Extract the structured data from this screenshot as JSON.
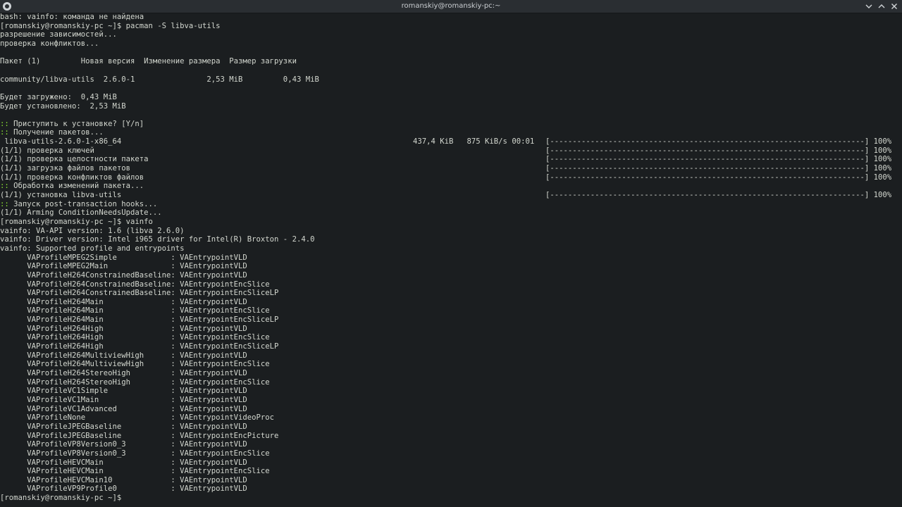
{
  "window": {
    "title": "romanskiy@romanskiy-pc:~",
    "icons": {
      "app": "terminal-app-icon",
      "minimize": "minimize-icon",
      "maximize": "maximize-icon",
      "close": "close-icon"
    }
  },
  "terminal": {
    "lines": [
      "bash: vainfo: команда не найдена",
      "[romanskiy@romanskiy-pc ~]$ pacman -S libva-utils",
      "разрешение зависимостей...",
      "проверка конфликтов...",
      "",
      "Пакет (1)         Новая версия  Изменение размера  Размер загрузки",
      "",
      "community/libva-utils  2.6.0-1                2,53 MiB         0,43 MiB",
      "",
      "Будет загружено:  0,43 MiB",
      "Будет установлено:  2,53 MiB",
      "",
      ":: Приступить к установке? [Y/n]",
      ":: Получение пакетов...",
      " libva-utils-2.6.0-1-x86_64",
      "(1/1) проверка ключей",
      "(1/1) проверка целостности пакета",
      "(1/1) загрузка файлов пакетов",
      "(1/1) проверка конфликтов файлов",
      ":: Обработка изменений пакета...",
      "(1/1) установка libva-utils",
      ":: Запуск post-transaction hooks...",
      "(1/1) Arming ConditionNeedsUpdate...",
      "[romanskiy@romanskiy-pc ~]$ vainfo",
      "vainfo: VA-API version: 1.6 (libva 2.6.0)",
      "vainfo: Driver version: Intel i965 driver for Intel(R) Broxton - 2.4.0",
      "vainfo: Supported profile and entrypoints",
      "      VAProfileMPEG2Simple            : VAEntrypointVLD",
      "      VAProfileMPEG2Main              : VAEntrypointVLD",
      "      VAProfileH264ConstrainedBaseline: VAEntrypointVLD",
      "      VAProfileH264ConstrainedBaseline: VAEntrypointEncSlice",
      "      VAProfileH264ConstrainedBaseline: VAEntrypointEncSliceLP",
      "      VAProfileH264Main               : VAEntrypointVLD",
      "      VAProfileH264Main               : VAEntrypointEncSlice",
      "      VAProfileH264Main               : VAEntrypointEncSliceLP",
      "      VAProfileH264High               : VAEntrypointVLD",
      "      VAProfileH264High               : VAEntrypointEncSlice",
      "      VAProfileH264High               : VAEntrypointEncSliceLP",
      "      VAProfileH264MultiviewHigh      : VAEntrypointVLD",
      "      VAProfileH264MultiviewHigh      : VAEntrypointEncSlice",
      "      VAProfileH264StereoHigh         : VAEntrypointVLD",
      "      VAProfileH264StereoHigh         : VAEntrypointEncSlice",
      "      VAProfileVC1Simple              : VAEntrypointVLD",
      "      VAProfileVC1Main                : VAEntrypointVLD",
      "      VAProfileVC1Advanced            : VAEntrypointVLD",
      "      VAProfileNone                   : VAEntrypointVideoProc",
      "      VAProfileJPEGBaseline           : VAEntrypointVLD",
      "      VAProfileJPEGBaseline           : VAEntrypointEncPicture",
      "      VAProfileVP8Version0_3          : VAEntrypointVLD",
      "      VAProfileVP8Version0_3          : VAEntrypointEncSlice",
      "      VAProfileHEVCMain               : VAEntrypointVLD",
      "      VAProfileHEVCMain               : VAEntrypointEncSlice",
      "      VAProfileHEVCMain10             : VAEntrypointVLD",
      "      VAProfileVP9Profile0            : VAEntrypointVLD",
      "[romanskiy@romanskiy-pc ~]$ "
    ],
    "colored_lines": [
      12,
      13,
      19,
      21
    ],
    "download_stats": "437,4 KiB   875 KiB/s 00:01",
    "progress_bar": "[----------------------------------------------------------------------] 100%",
    "progress_lines": [
      14,
      15,
      16,
      17,
      18,
      20
    ],
    "progress_percent": 100,
    "cursor_line": 55,
    "colors": {
      "background": "#1b1e20",
      "text": "#d3d7cf",
      "prompt_marker": "#8ae234"
    }
  }
}
